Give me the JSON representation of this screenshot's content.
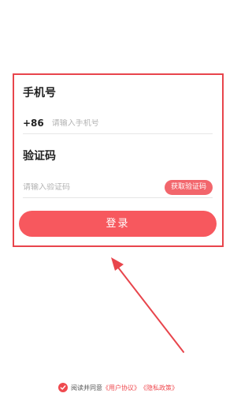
{
  "form": {
    "phone_title": "手机号",
    "country_code": "+86",
    "phone_placeholder": "请输入手机号",
    "code_title": "验证码",
    "code_placeholder": "请输入验证码",
    "get_code_label": "获取验证码",
    "login_label": "登录"
  },
  "agreement": {
    "prefix": "阅读并同意",
    "user_agreement": "《用户协议》",
    "privacy_policy": "《隐私政策》",
    "checked": true
  },
  "colors": {
    "accent": "#f7585e",
    "highlight": "#e8454c",
    "button_secondary": "#f2666c"
  },
  "icons": {
    "agreement_check": "check-circle-icon",
    "annotation": "annotation-arrow"
  }
}
